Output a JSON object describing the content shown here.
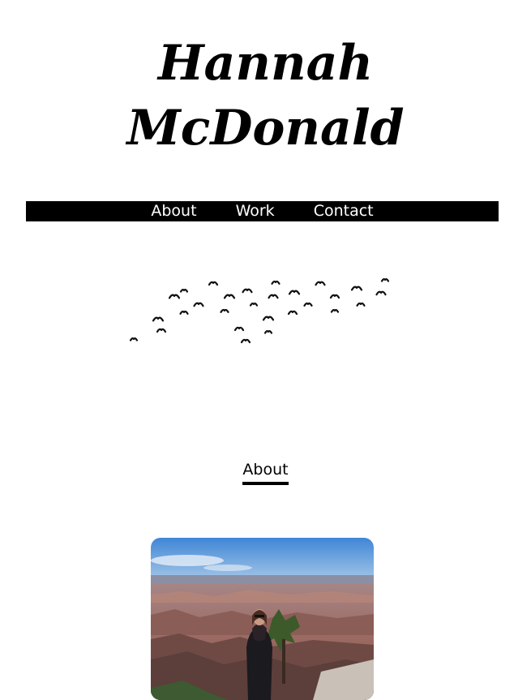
{
  "header": {
    "title_line1": "Hannah",
    "title_line2": "McDonald"
  },
  "nav": {
    "items": [
      "About",
      "Work",
      "Contact"
    ]
  },
  "decoration": {
    "icon": "flock-of-birds"
  },
  "about": {
    "heading": "About"
  },
  "photo": {
    "subject": "person-at-canyon-overlook"
  },
  "colors": {
    "nav_background": "#000000",
    "nav_text": "#ffffff",
    "text": "#000000",
    "background": "#ffffff"
  }
}
